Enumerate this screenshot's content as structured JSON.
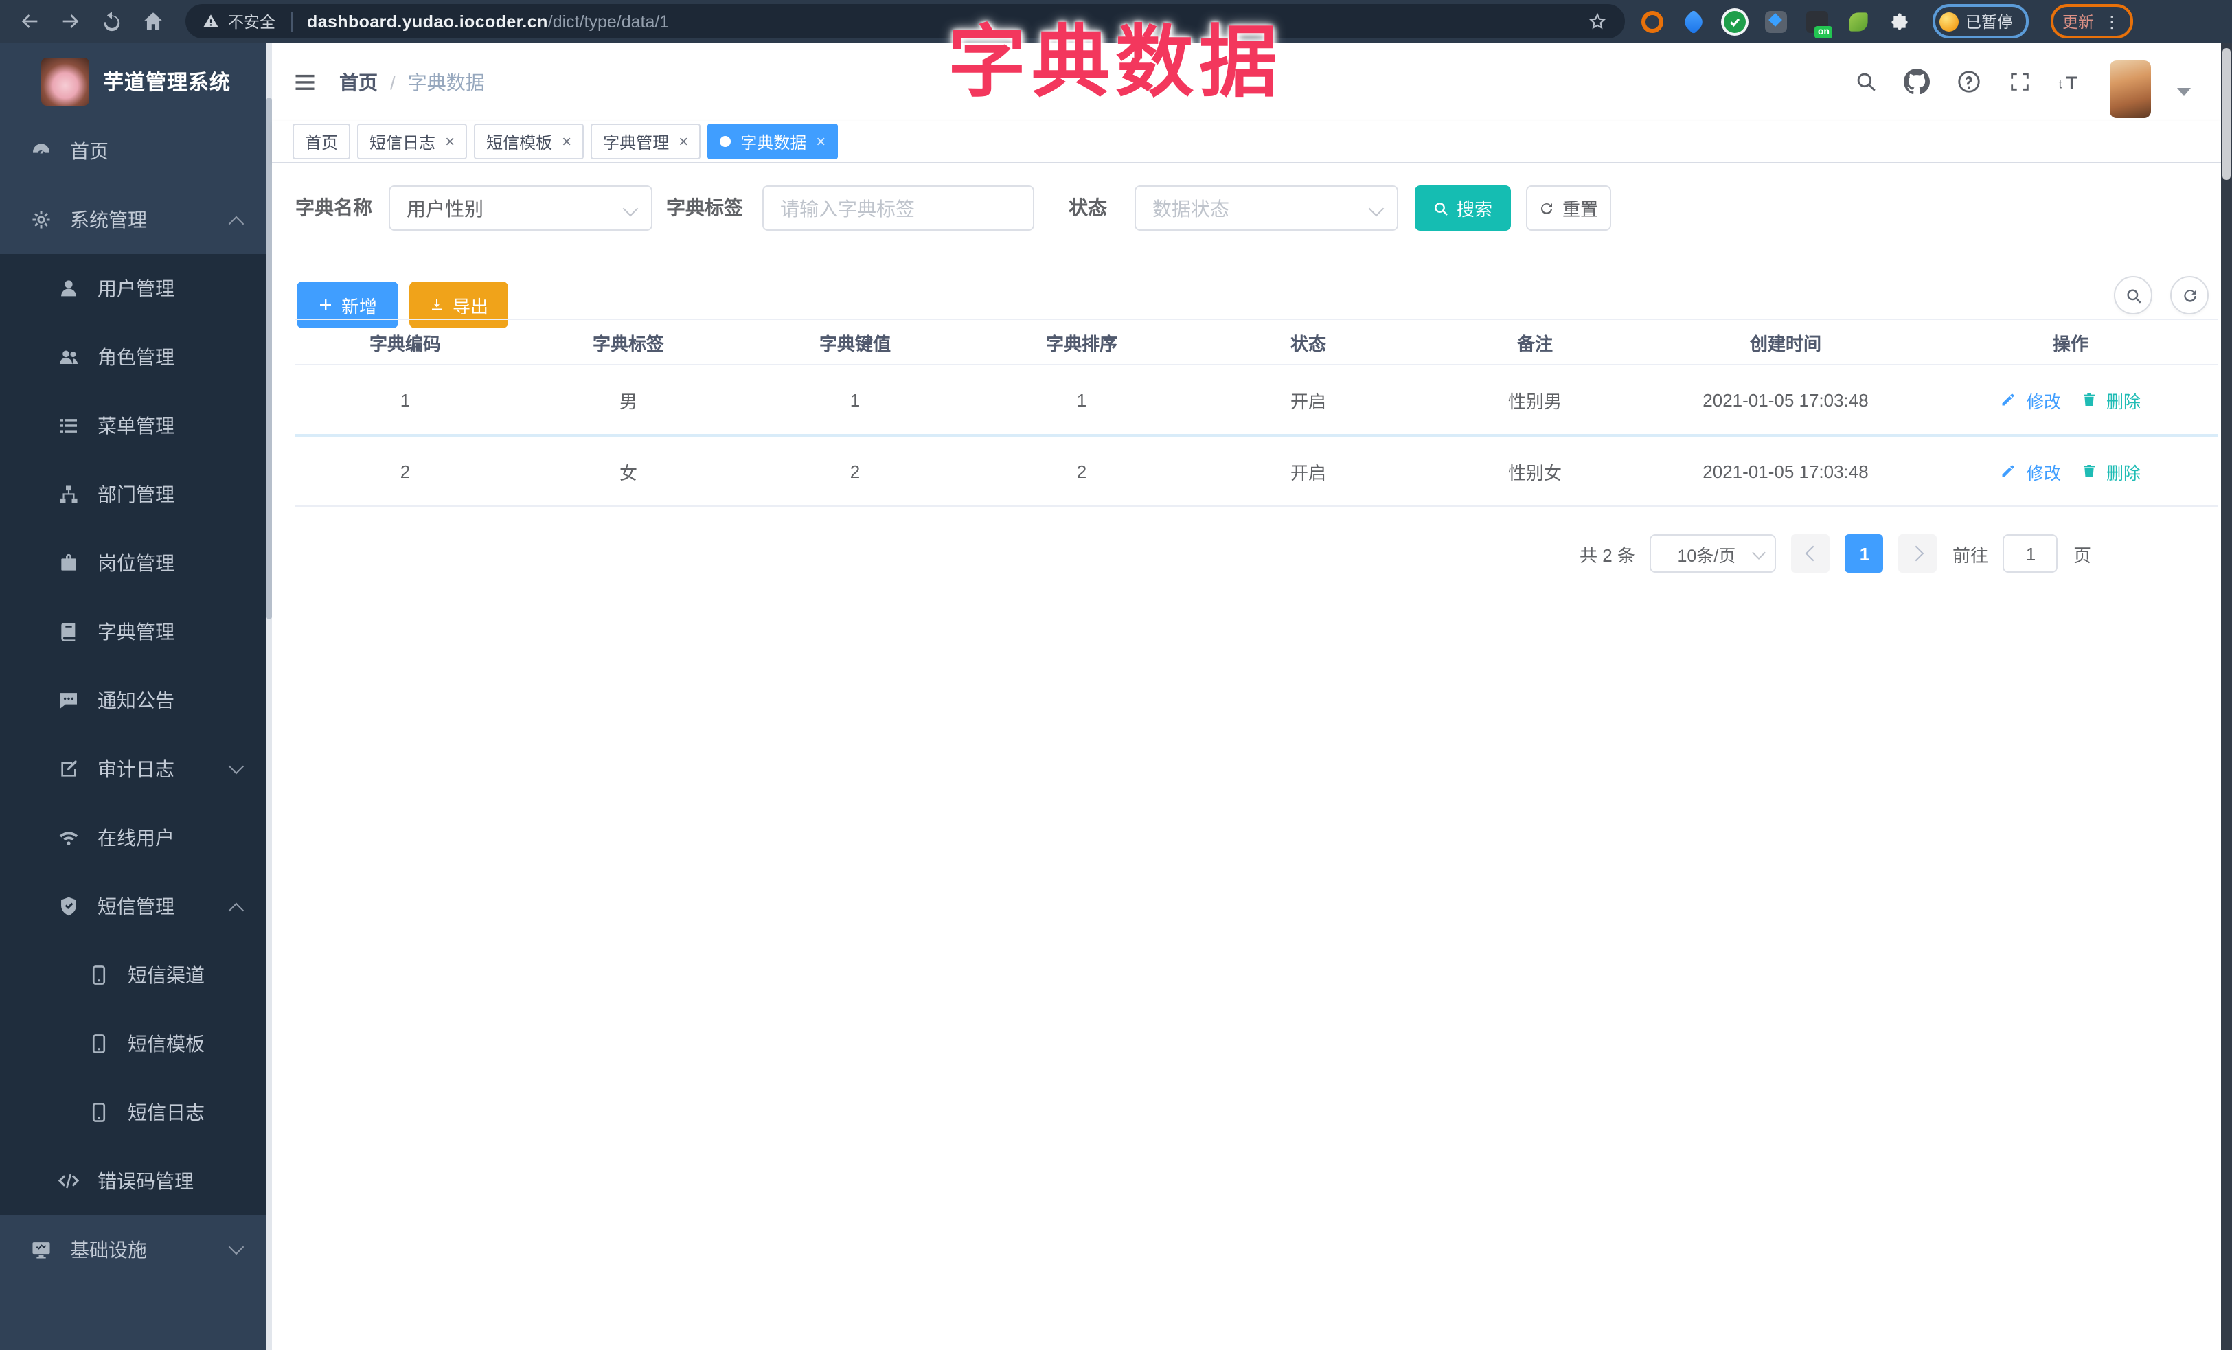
{
  "browser": {
    "security_label": "不安全",
    "url_host": "dashboard.yudao.iocoder.cn",
    "url_path": "/dict/type/data/1",
    "paused_label": "已暂停",
    "update_label": "更新",
    "on_badge": "on"
  },
  "overlay": {
    "title": "字典数据",
    "color": "#F3375D"
  },
  "sidebar": {
    "title": "芋道管理系统",
    "items": [
      {
        "key": "home",
        "label": "首页",
        "icon": "dashboard",
        "level": 0
      },
      {
        "key": "system-management",
        "label": "系统管理",
        "icon": "gear",
        "level": 0,
        "chevron": "up"
      },
      {
        "key": "user-management",
        "label": "用户管理",
        "icon": "user",
        "level": 1
      },
      {
        "key": "role-management",
        "label": "角色管理",
        "icon": "users",
        "level": 1
      },
      {
        "key": "menu-management",
        "label": "菜单管理",
        "icon": "menu",
        "level": 1
      },
      {
        "key": "dept-management",
        "label": "部门管理",
        "icon": "tree",
        "level": 1
      },
      {
        "key": "post-management",
        "label": "岗位管理",
        "icon": "badge",
        "level": 1
      },
      {
        "key": "dict-management",
        "label": "字典管理",
        "icon": "book",
        "level": 1
      },
      {
        "key": "notice-announcement",
        "label": "通知公告",
        "icon": "message",
        "level": 1
      },
      {
        "key": "audit-log",
        "label": "审计日志",
        "icon": "log",
        "level": 1,
        "chevron": "down"
      },
      {
        "key": "online-users",
        "label": "在线用户",
        "icon": "online",
        "level": 1
      },
      {
        "key": "sms-management",
        "label": "短信管理",
        "icon": "shield",
        "level": 1,
        "chevron": "up"
      },
      {
        "key": "sms-channel",
        "label": "短信渠道",
        "icon": "phone",
        "level": 2
      },
      {
        "key": "sms-template",
        "label": "短信模板",
        "icon": "phone",
        "level": 2
      },
      {
        "key": "sms-log",
        "label": "短信日志",
        "icon": "phone",
        "level": 2
      },
      {
        "key": "error-code-management",
        "label": "错误码管理",
        "icon": "code",
        "level": 1
      },
      {
        "key": "infrastructure",
        "label": "基础设施",
        "icon": "monitor",
        "level": 0,
        "chevron": "down"
      }
    ]
  },
  "header": {
    "breadcrumb": [
      "首页",
      "字典数据"
    ]
  },
  "tabs": [
    {
      "key": "home",
      "label": "首页",
      "closable": false,
      "active": false
    },
    {
      "key": "sms-log",
      "label": "短信日志",
      "closable": true,
      "active": false
    },
    {
      "key": "sms-template",
      "label": "短信模板",
      "closable": true,
      "active": false
    },
    {
      "key": "dict-management",
      "label": "字典管理",
      "closable": true,
      "active": false
    },
    {
      "key": "dict-data",
      "label": "字典数据",
      "closable": true,
      "active": true
    }
  ],
  "filters": {
    "dict_name_label": "字典名称",
    "dict_name_value": "用户性别",
    "dict_label_label": "字典标签",
    "dict_label_placeholder": "请输入字典标签",
    "status_label": "状态",
    "status_placeholder": "数据状态",
    "search_label": "搜索",
    "reset_label": "重置"
  },
  "toolbar": {
    "add_label": "新增",
    "export_label": "导出"
  },
  "table": {
    "headers": [
      "字典编码",
      "字典标签",
      "字典键值",
      "字典排序",
      "状态",
      "备注",
      "创建时间",
      "操作"
    ],
    "rows": [
      {
        "code": "1",
        "label": "男",
        "value": "1",
        "sort": "1",
        "status": "开启",
        "remark": "性别男",
        "created": "2021-01-05 17:03:48"
      },
      {
        "code": "2",
        "label": "女",
        "value": "2",
        "sort": "2",
        "status": "开启",
        "remark": "性别女",
        "created": "2021-01-05 17:03:48"
      }
    ],
    "actions": {
      "edit": "修改",
      "delete": "删除"
    }
  },
  "pagination": {
    "total": "共 2 条",
    "page_size": "10条/页",
    "current": "1",
    "goto_label": "前往",
    "goto_value": "1",
    "page_unit": "页"
  },
  "colors": {
    "accent": "#409EFF",
    "search_teal": "#15BDB2",
    "export_orange": "#F0A31A",
    "edit_link": "#409EFF",
    "delete_link": "#1FBCB5",
    "overlay_red": "#F3375D"
  }
}
